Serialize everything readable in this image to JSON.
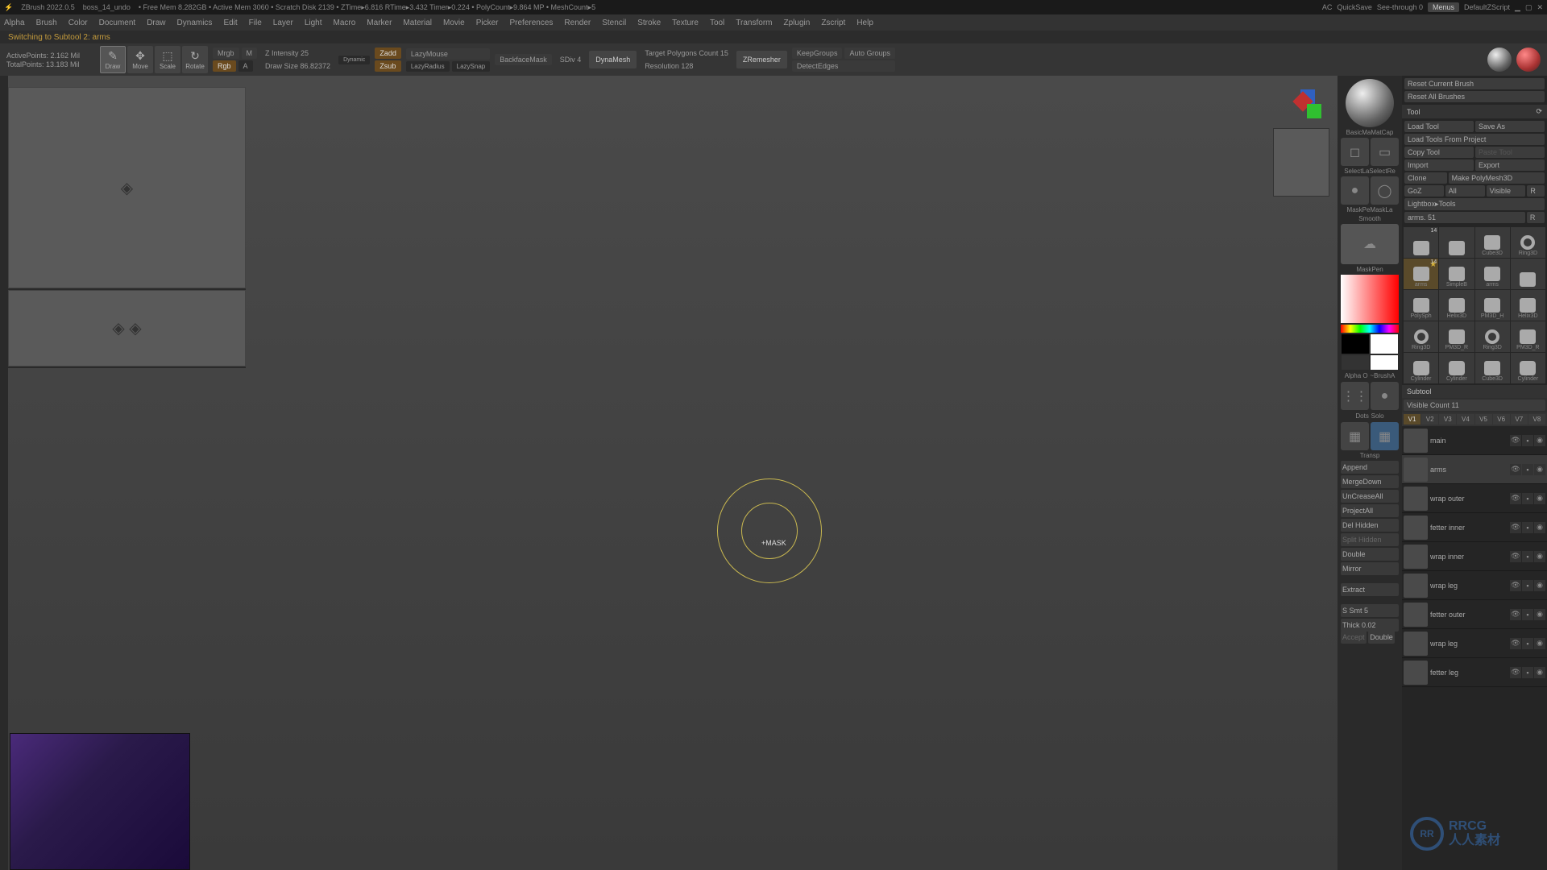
{
  "titlebar": {
    "app": "ZBrush 2022.0.5",
    "file": "boss_14_undo",
    "stats": "• Free Mem 8.282GB • Active Mem 3060 • Scratch Disk 2139 • ZTime▸6.816 RTime▸3.432 Timer▸0.224 • PolyCount▸9.864 MP • MeshCount▸5",
    "ac": "AC",
    "quicksave": "QuickSave",
    "seethrough": "See-through  0",
    "menus": "Menus",
    "zscript": "DefaultZScript"
  },
  "menubar": [
    "Alpha",
    "Brush",
    "Color",
    "Document",
    "Draw",
    "Dynamics",
    "Edit",
    "File",
    "Layer",
    "Light",
    "Macro",
    "Marker",
    "Material",
    "Movie",
    "Picker",
    "Preferences",
    "Render",
    "Stencil",
    "Stroke",
    "Texture",
    "Tool",
    "Transform",
    "Zplugin",
    "Zscript",
    "Help"
  ],
  "status": "Switching to Subtool 2:   arms",
  "toolbar": {
    "active_points": "ActivePoints: 2.162 Mil",
    "total_points": "TotalPoints: 13.183 Mil",
    "modes": [
      {
        "icon": "✎",
        "label": "Draw",
        "active": true
      },
      {
        "icon": "✥",
        "label": "Move"
      },
      {
        "icon": "⟲",
        "label": "Scale"
      },
      {
        "icon": "↻",
        "label": "Rotate"
      }
    ],
    "mrgb": "Mrgb",
    "m": "M",
    "rgb": "Rgb",
    "a": "A",
    "zintensity": "Z Intensity 25",
    "drawsize": "Draw Size 86.82372",
    "dynamic": "Dynamic",
    "zadd": "Zadd",
    "zsub": "Zsub",
    "lazymouse": "LazyMouse",
    "lazyradius": "LazyRadius",
    "lazysnap": "LazySnap",
    "backface": "BackfaceMask",
    "sdiv": "SDiv 4",
    "dynamesh": "DynaMesh",
    "target_poly": "Target Polygons Count 15",
    "resolution": "Resolution 128",
    "zremesher": "ZRemesher",
    "keepgroups": "KeepGroups",
    "autogroups": "Auto Groups",
    "detectedges": "DetectEdges"
  },
  "rsb1": {
    "mat_label": "BasicMaMatCap",
    "brush_labels": [
      "SelectLaSelectRe",
      "MaskPeMaskLa",
      "Smooth",
      "MaskPen"
    ],
    "alpha": "Alpha O",
    "brush_alpha": "~BrushA",
    "stroke": "Dots",
    "solo": "Solo",
    "transp": "Transp",
    "actions": [
      "Append",
      "MergeDown",
      "UnCreaseAll",
      "ProjectAll",
      "Del Hidden",
      "Split Hidden",
      "Double",
      "Mirror",
      "",
      "Extract",
      "",
      "S Smt 5",
      "Thick 0.02"
    ],
    "accept": "Accept",
    "double2": "Double"
  },
  "rsb2": {
    "reset_brush": "Reset Current Brush",
    "reset_all": "Reset All Brushes",
    "tool_hdr": "Tool",
    "load_tool": "Load Tool",
    "save_as": "Save As",
    "load_proj": "Load Tools From Project",
    "copy_tool": "Copy Tool",
    "paste_tool": "Paste Tool",
    "import": "Import",
    "export": "Export",
    "clone": "Clone",
    "polymesh": "Make PolyMesh3D",
    "goz": "GoZ",
    "all": "All",
    "visible": "Visible",
    "r": "R",
    "lightbox": "Lightbox▸Tools",
    "current": "arms. 51",
    "r2": "R",
    "tool_grid": [
      {
        "lbl": "",
        "num": "14"
      },
      {
        "lbl": ""
      },
      {
        "lbl": "Cube3D"
      },
      {
        "lbl": "Ring3D"
      },
      {
        "lbl": "arms",
        "gold": true,
        "num": "14"
      },
      {
        "lbl": "SimpleB"
      },
      {
        "lbl": "arms"
      },
      {
        "lbl": ""
      },
      {
        "lbl": "PolySph"
      },
      {
        "lbl": "Helix3D"
      },
      {
        "lbl": "PM3D_H"
      },
      {
        "lbl": "Helix3D"
      },
      {
        "lbl": "Ring3D"
      },
      {
        "lbl": "PM3D_R"
      },
      {
        "lbl": "Ring3D"
      },
      {
        "lbl": "PM3D_R"
      },
      {
        "lbl": "Cylinder"
      },
      {
        "lbl": "Cylinder"
      },
      {
        "lbl": "Cube3D"
      },
      {
        "lbl": "Cylinder"
      }
    ],
    "subtool_hdr": "Subtool",
    "visible_count": "Visible Count 11",
    "vbuttons": [
      "V1",
      "V2",
      "V3",
      "V4",
      "V5",
      "V6",
      "V7",
      "V8"
    ],
    "subtools": [
      {
        "name": "main"
      },
      {
        "name": "arms",
        "active": true
      },
      {
        "name": "wrap outer"
      },
      {
        "name": "fetter inner"
      },
      {
        "name": "wrap inner"
      },
      {
        "name": "wrap leg"
      },
      {
        "name": "fetter outer"
      },
      {
        "name": "wrap leg"
      },
      {
        "name": "fetter leg"
      }
    ]
  },
  "cursor_label": "+MASK",
  "watermark": "RRCG\n人人素材"
}
